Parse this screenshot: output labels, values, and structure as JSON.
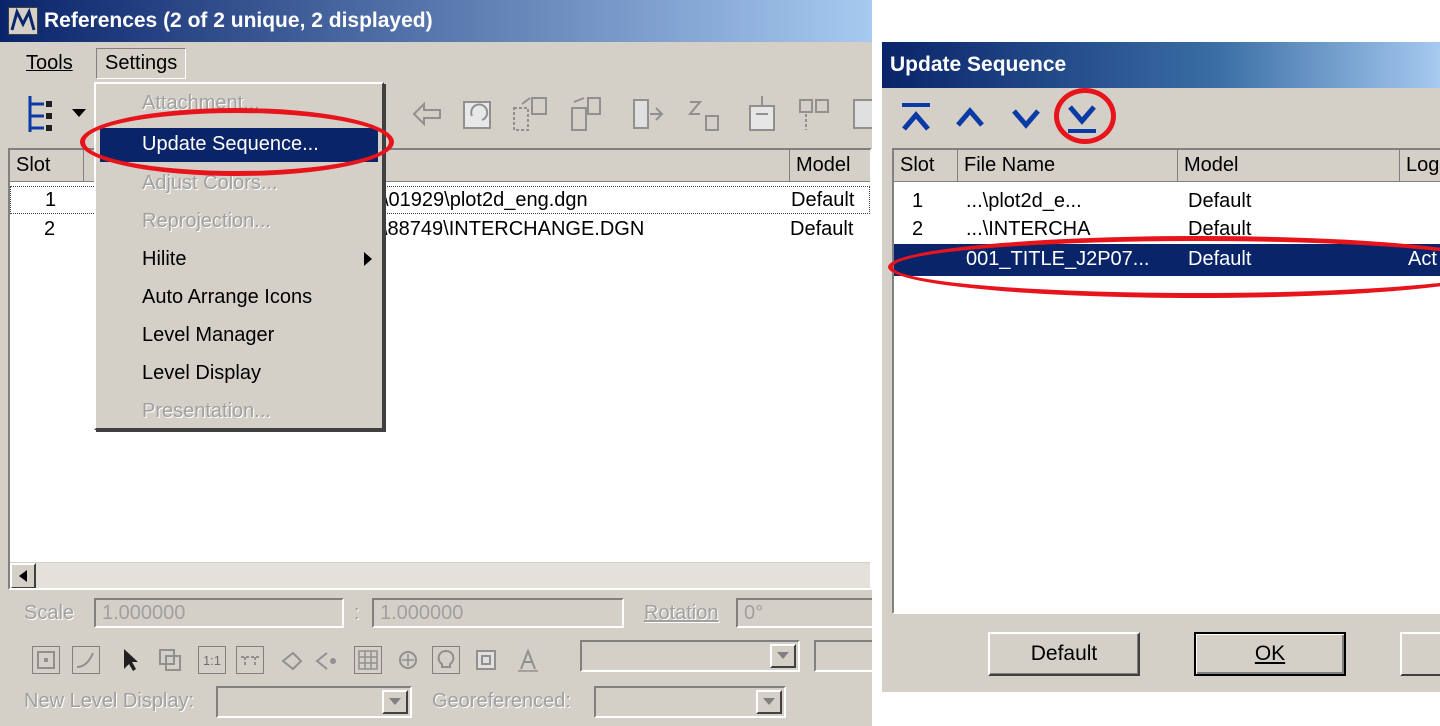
{
  "references": {
    "title": "References (2 of 2 unique, 2 displayed)",
    "menu": {
      "tools": "Tools",
      "settings": "Settings"
    },
    "columns": {
      "slot": "Slot",
      "model": "Model"
    },
    "rows": [
      {
        "slot": "1",
        "file": "\\01929\\plot2d_eng.dgn",
        "model": "Default"
      },
      {
        "slot": "2",
        "file": "\\88749\\INTERCHANGE.DGN",
        "model": "Default"
      }
    ],
    "settings_menu": [
      {
        "label": "Attachment...",
        "enabled": false
      },
      {
        "label": "Update Sequence...",
        "enabled": true,
        "highlighted": true
      },
      {
        "label": "Adjust Colors...",
        "enabled": false
      },
      {
        "label": "Reprojection...",
        "enabled": false
      },
      {
        "label": "Hilite",
        "enabled": true,
        "submenu": true
      },
      {
        "label": "Auto Arrange Icons",
        "enabled": true
      },
      {
        "label": "Level Manager",
        "enabled": true
      },
      {
        "label": "Level Display",
        "enabled": true
      },
      {
        "label": "Presentation...",
        "enabled": false
      }
    ],
    "scale_label": "Scale",
    "scale_value1": "1.000000",
    "scale_sep": ":",
    "scale_value2": "1.000000",
    "rotation_label": "Rotation",
    "rotation_value": "0°",
    "new_level_display_label": "New Level Display:",
    "georeferenced_label": "Georeferenced:",
    "ratio_icon_text": "1:1"
  },
  "update_sequence": {
    "title": "Update Sequence",
    "columns": {
      "slot": "Slot",
      "file_name": "File Name",
      "model": "Model",
      "logical": "Log"
    },
    "rows": [
      {
        "slot": "1",
        "file": "...\\plot2d_e...",
        "model": "Default",
        "logical": "",
        "selected": false
      },
      {
        "slot": "2",
        "file": "...\\INTERCHA",
        "model": "Default",
        "logical": "",
        "selected": false
      },
      {
        "slot": "",
        "file": "001_TITLE_J2P07...",
        "model": "Default",
        "logical": "Act",
        "selected": true
      }
    ],
    "buttons": {
      "default": "Default",
      "ok": "OK"
    }
  },
  "colors": {
    "title_gradient_start": "#0a246a",
    "title_gradient_end": "#a6caf0",
    "highlight": "#0a246a",
    "annotation": "#e8141c",
    "arrow_blue": "#0a3aa6"
  }
}
